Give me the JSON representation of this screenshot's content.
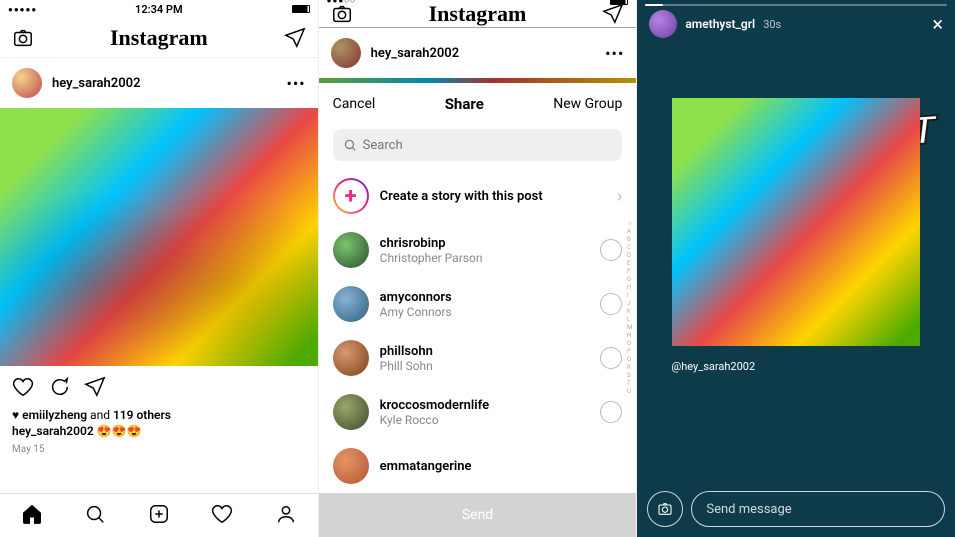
{
  "feed": {
    "time": "12:34 PM",
    "logo": "Instagram",
    "post": {
      "user": "hey_sarah2002",
      "more": "•••",
      "liker": "emiilyzheng",
      "likes_mid": "and",
      "likes_count": "119 others",
      "caption": "😍😍😍",
      "date": "May 15"
    }
  },
  "share": {
    "cancel": "Cancel",
    "title": "Share",
    "new_group": "New Group",
    "search_placeholder": "Search",
    "create_story": "Create a story with this post",
    "send": "Send",
    "contacts": [
      {
        "handle": "chrisrobinp",
        "name": "Christopher Parson"
      },
      {
        "handle": "amyconnors",
        "name": "Amy Connors"
      },
      {
        "handle": "phillsohn",
        "name": "Phill Sohn"
      },
      {
        "handle": "kroccosmodernlife",
        "name": "Kyle Rocco"
      },
      {
        "handle": "emmatangerine",
        "name": ""
      }
    ]
  },
  "story": {
    "user": "amethyst_grl",
    "time": "30s",
    "sticker": "WANT",
    "mention": "@hey_sarah2002",
    "msg_placeholder": "Send message"
  }
}
